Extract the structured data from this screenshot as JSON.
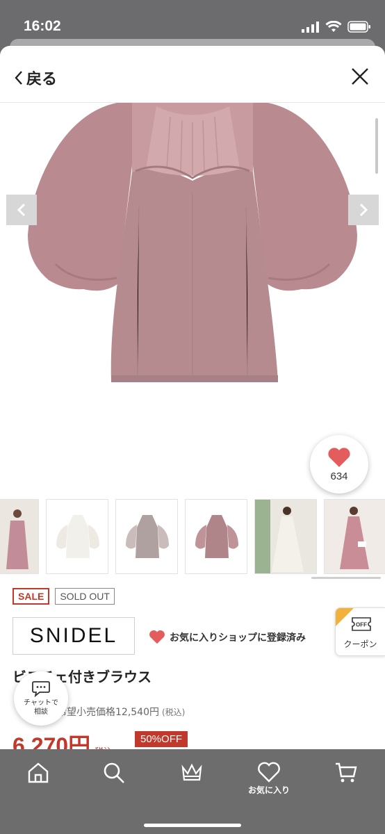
{
  "status": {
    "time": "16:02"
  },
  "header": {
    "back_label": "戻る"
  },
  "favorite": {
    "count": "634"
  },
  "badges": {
    "sale": "SALE",
    "sold_out": "SOLD OUT"
  },
  "brand": {
    "name": "SNIDEL"
  },
  "shop_favorite": {
    "label": "お気に入りショップに登録済み"
  },
  "coupon": {
    "icon_text": "OFF",
    "label": "クーポン"
  },
  "product": {
    "title": "ビスチェ付きブラウス",
    "reference_price": "希望小売価格12,540円",
    "reference_tax": "(税込)",
    "price": "6,270円",
    "price_tax": "税込",
    "discount": "50%OFF"
  },
  "chat": {
    "line1": "チャットで",
    "line2": "相談"
  },
  "tab_bar": {
    "favorites_label": "お気に入り"
  },
  "colors": {
    "accent_red": "#c0392b",
    "heart": "#e35d5d",
    "blouse_pink": "#b98a8f",
    "coupon_corner": "#f1b13b"
  }
}
